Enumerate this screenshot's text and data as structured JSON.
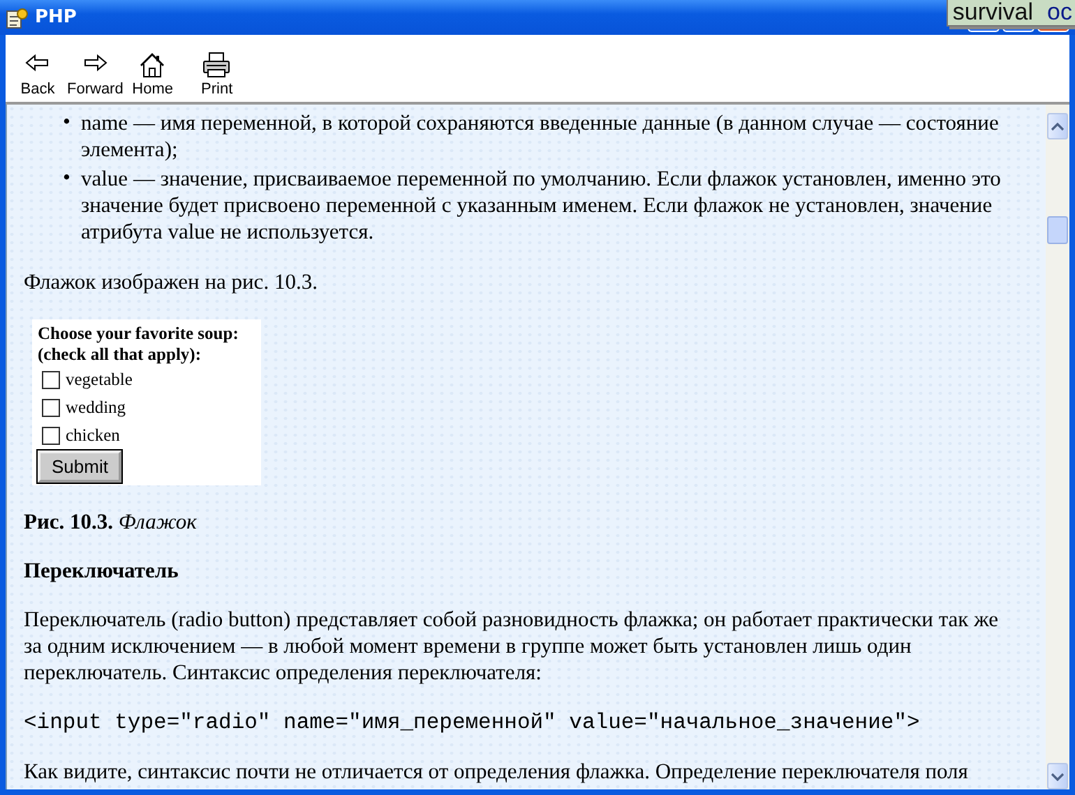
{
  "window": {
    "title": "PHP"
  },
  "overlay_tabs": [
    "survival",
    "oc"
  ],
  "toolbar": [
    {
      "kind": "back",
      "label": "Back"
    },
    {
      "kind": "forward",
      "label": "Forward"
    },
    {
      "kind": "home",
      "label": "Home"
    },
    {
      "kind": "print",
      "label": "Print"
    }
  ],
  "content": [
    {
      "kind": "list",
      "bullet": "•",
      "items": [
        "name — имя переменной, в которой сохраняются введенные данные (в данном случае — состояние элемента);",
        "value — значение, присваиваемое переменной по умолчанию. Если флажок установлен, именно это значение будет присвоено переменной с указанным именем. Если флажок не установлен, значение атрибута value не используется."
      ]
    },
    {
      "kind": "paragraph",
      "text": "Флажок изображен на рис. 10.3."
    },
    {
      "kind": "form",
      "heading": "Choose your favorite soup:",
      "subheading": "(check all that apply):",
      "options": [
        {
          "label": "vegetable",
          "checked": false
        },
        {
          "label": "wedding",
          "checked": false
        },
        {
          "label": "chicken",
          "checked": false
        }
      ],
      "button": "Submit"
    },
    {
      "kind": "caption",
      "text": "**Рис. 10.3.** *Флажок*"
    },
    {
      "kind": "heading",
      "text": "Переключатель"
    },
    {
      "kind": "paragraph",
      "text": "Переключатель (radio button) представляет собой разновидность флажка; он работает практически так же за одним исключением — в любой момент времени в группе может быть установлен лишь один переключатель. Синтаксис определения переключателя:"
    },
    {
      "kind": "code",
      "text": "<input type=\"radio\" name=\"имя_переменной\" value=\"начальное_значение\">"
    },
    {
      "kind": "paragraph",
      "text": "Как видите, синтаксис почти не отличается от определения флажка. Определение переключателя поля"
    }
  ]
}
